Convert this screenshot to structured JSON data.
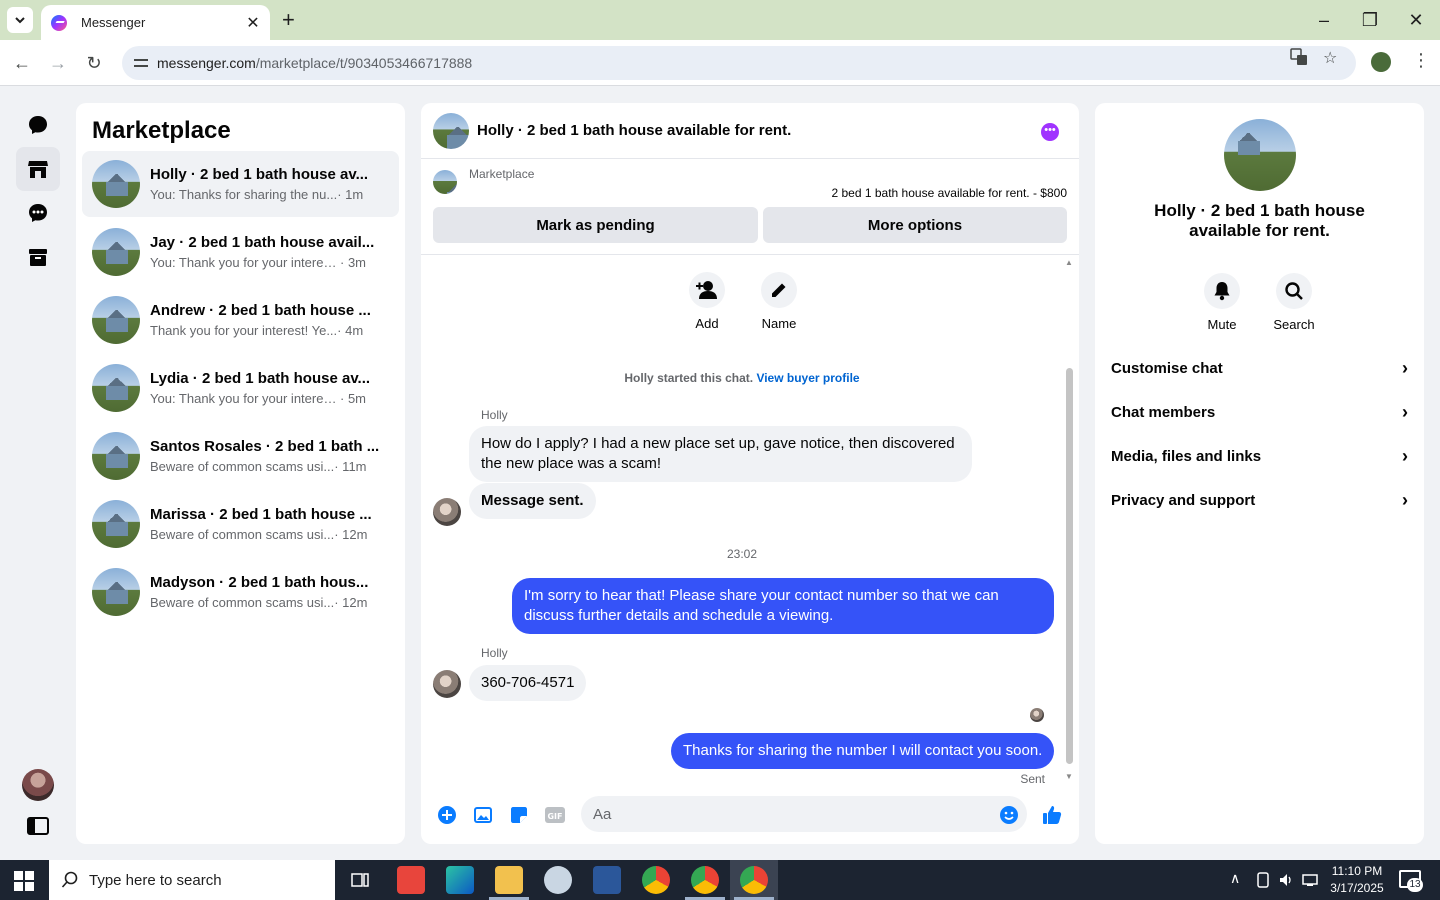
{
  "browser": {
    "tab_title": "Messenger",
    "url_host": "messenger.com",
    "url_path": "/marketplace/t/9034053466717888"
  },
  "left": {
    "title": "Marketplace",
    "conversations": [
      {
        "name": "Holly · 2 bed 1 bath house av...",
        "snippet": "You: Thanks for sharing the nu...",
        "time": " · 1m"
      },
      {
        "name": "Jay · 2 bed 1 bath house avail...",
        "snippet": "You: Thank you for your interes...",
        "time": " · 3m"
      },
      {
        "name": "Andrew · 2 bed 1 bath house ...",
        "snippet": "Thank you for your interest! Ye...",
        "time": " · 4m"
      },
      {
        "name": "Lydia · 2 bed 1 bath house av...",
        "snippet": "You: Thank you for your interes...",
        "time": " · 5m"
      },
      {
        "name": "Santos Rosales · 2 bed 1 bath ...",
        "snippet": "Beware of common scams usi...",
        "time": " · 11m"
      },
      {
        "name": "Marissa · 2 bed 1 bath house ...",
        "snippet": "Beware of common scams usi...",
        "time": " · 12m"
      },
      {
        "name": "Madyson · 2 bed 1 bath hous...",
        "snippet": "Beware of common scams usi...",
        "time": " · 12m"
      }
    ]
  },
  "chat": {
    "title": "Holly · 2 bed 1 bath house available for rent.",
    "marketplace_label": "Marketplace",
    "listing": "2 bed 1 bath house available for rent. - $800",
    "mark_pending": "Mark as pending",
    "more_options": "More options",
    "add_label": "Add",
    "name_label": "Name",
    "started_text": "Holly started this chat.",
    "view_profile": "View buyer profile",
    "sender_name": "Holly",
    "msg1": "How do I apply? I had a new place set up, gave notice, then discovered the new place was a scam!",
    "msg2": "Message sent.",
    "time_sep": "23:02",
    "msg3": "I'm sorry to hear that! Please share your contact number so that we can discuss further details and schedule a viewing.",
    "msg4": "360-706-4571",
    "msg5": "Thanks for sharing the number I will contact you soon.",
    "sent": "Sent",
    "composer_placeholder": "Aa"
  },
  "right": {
    "title": "Holly · 2 bed 1 bath house available for rent.",
    "mute": "Mute",
    "search": "Search",
    "items": [
      "Customise chat",
      "Chat members",
      "Media, files and links",
      "Privacy and support"
    ]
  },
  "taskbar": {
    "search_placeholder": "Type here to search",
    "time": "11:10 PM",
    "date": "3/17/2025",
    "notif_count": "13"
  },
  "colors": {
    "accent": "#0064d1",
    "outgoing_bubble": "#3553f8",
    "more_button": "#a033ff"
  }
}
